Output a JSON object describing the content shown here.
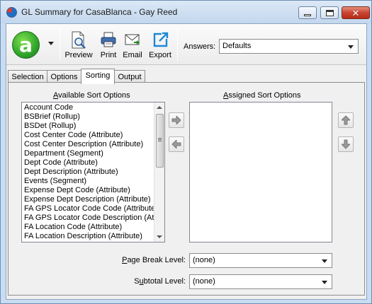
{
  "window": {
    "title": "GL Summary for CasaBlanca - Gay Reed"
  },
  "toolbar": {
    "logo_letter": "a",
    "preview_label": "Preview",
    "print_label": "Print",
    "email_label": "Email",
    "export_label": "Export",
    "answers_label": "Answers:",
    "answers_value": "Defaults"
  },
  "tabs": [
    {
      "label": "Selection",
      "active": false
    },
    {
      "label": "Options",
      "active": false
    },
    {
      "label": "Sorting",
      "active": true
    },
    {
      "label": "Output",
      "active": false
    }
  ],
  "sorting": {
    "available_label_first": "A",
    "available_label_rest": "vailable Sort Options",
    "assigned_label_first": "A",
    "assigned_label_rest": "ssigned Sort Options",
    "available_items": [
      "Account Code",
      "BSBrief (Rollup)",
      "BSDet (Rollup)",
      "Cost Center Code (Attribute)",
      "Cost Center Description (Attribute)",
      "Department (Segment)",
      "Dept Code (Attribute)",
      "Dept Description (Attribute)",
      "Events (Segment)",
      "Expense Dept Code (Attribute)",
      "Expense Dept Description (Attribute)",
      "FA GPS Locator Code Code (Attribute)",
      "FA GPS Locator Code Description (Attribute)",
      "FA Location Code (Attribute)",
      "FA Location Description (Attribute)"
    ],
    "assigned_items": [],
    "page_break_label_first": "P",
    "page_break_label_rest": "age Break Level:",
    "page_break_value": "(none)",
    "subtotal_label_first": "S",
    "subtotal_label_mid": "u",
    "subtotal_label_rest": "btotal Level:",
    "subtotal_value": "(none)"
  },
  "colors": {
    "logo_green": "#2ea52a",
    "close_red": "#c94431",
    "window_frame": "#c9dcf1"
  }
}
